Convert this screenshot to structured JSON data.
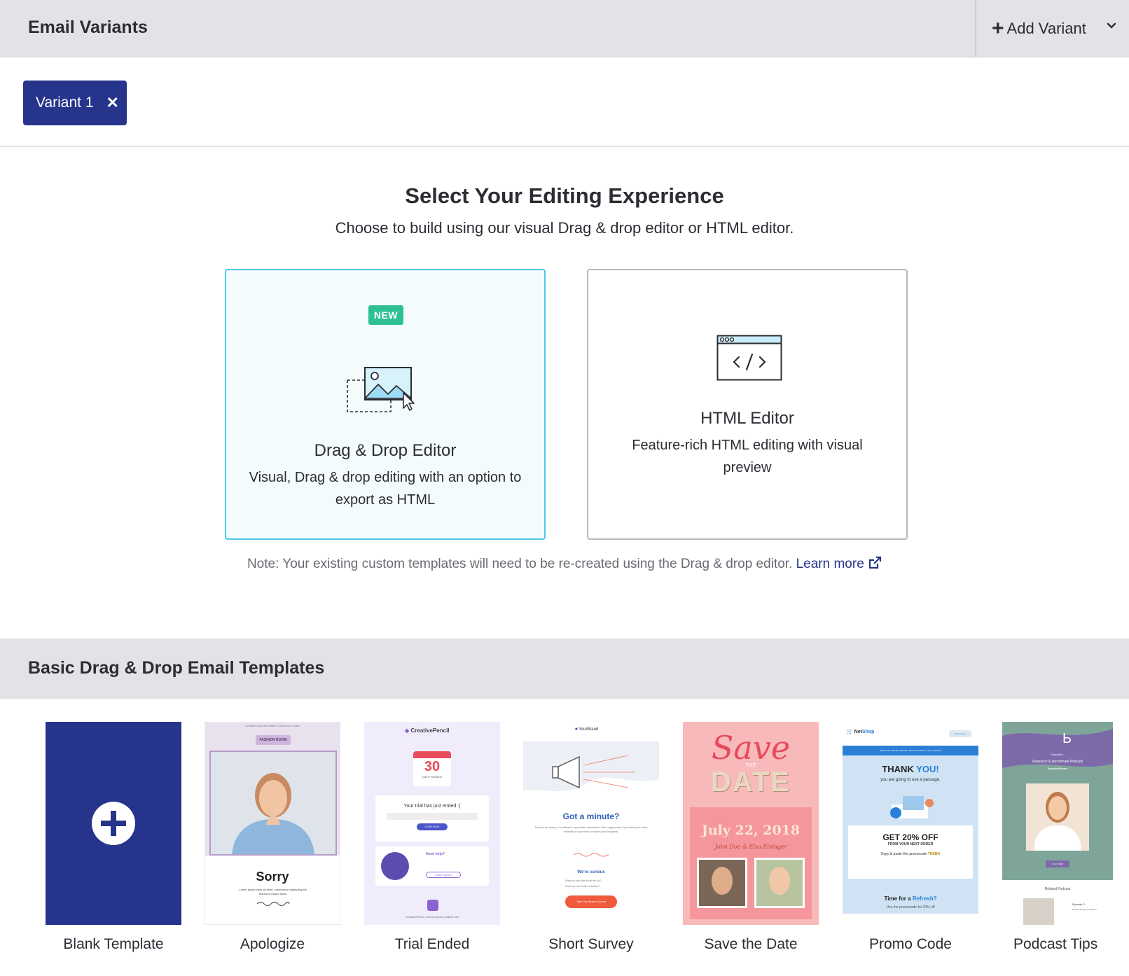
{
  "header": {
    "title": "Email Variants",
    "add_variant_label": "Add Variant"
  },
  "variants": [
    {
      "label": "Variant 1"
    }
  ],
  "editor_select": {
    "title": "Select Your Editing Experience",
    "subtitle": "Choose to build using our visual Drag & drop editor or HTML editor.",
    "drag_drop": {
      "badge": "NEW",
      "title": "Drag & Drop Editor",
      "description": "Visual, Drag & drop editing with an option to export as HTML"
    },
    "html": {
      "title": "HTML Editor",
      "description": "Feature-rich HTML editing with visual preview"
    },
    "note": "Note: Your existing custom templates will need to be re-created using the Drag & drop editor.",
    "learn_more": "Learn more"
  },
  "templates_section": {
    "title": "Basic Drag & Drop Email Templates",
    "templates": [
      {
        "label": "Blank Template"
      },
      {
        "label": "Apologize",
        "thumb": {
          "header": "Unable to see this email? Click here to view",
          "brand": "FASHION ROOM",
          "heading": "Sorry",
          "body": "Lorem ipsum dolor sit amet, consectetur adipiscing elit. Mauris ut neque tellus."
        }
      },
      {
        "label": "Trial Ended",
        "thumb": {
          "brand": "CreativePencil",
          "day": "30",
          "day_label": "DAYS PASSED",
          "heading": "Your trial has just ended :(",
          "button": "CONTINUE",
          "help": "Need help?",
          "help_button": "Lorem Ipsum",
          "footer": "CreativePencil, a lorem ipsum creative tool"
        }
      },
      {
        "label": "Short Survey",
        "thumb": {
          "brand": "YourBrand",
          "heading": "Got a minute?",
          "body": "Thanks for being a YourBrand' newsletter subscriber! We'd appreciate if you take just a few minutes of your time to share your thoughts.",
          "curious": "We're curious",
          "q1": "Why do you like what we do?",
          "q2": "How can we make it better?",
          "button": "Take YourBrand Survey"
        }
      },
      {
        "label": "Save the Date",
        "thumb": {
          "line1": "Save",
          "the": "THE",
          "line2": "DATE",
          "date": "July 22, 2018",
          "names": "John Doe & Elsa Elsinger"
        }
      },
      {
        "label": "Promo Code",
        "thumb": {
          "brand_a": "Net",
          "brand_b": "Shop",
          "account": "My account",
          "nav": "Electronics | Fashion | Books | Home and Kitchen | Toys | SALES",
          "thanks_a": "THANK ",
          "thanks_b": "YOU!",
          "thanks_sub": "you are going to use a passage.",
          "offer": "GET 20% OFF",
          "offer_sub": "FROM YOUR NEXT ORDER",
          "code_line": "Copy & paste this promocode",
          "code": "THEBO",
          "refresh_a": "Time for a ",
          "refresh_b": "Refresh?",
          "refresh_sub": "Use the promocode for 20% off"
        }
      },
      {
        "label": "Podcast Tips",
        "thumb": {
          "episode": "Episode 1",
          "heading": "Research & benchmark Podcast",
          "author": "Jessica Brown",
          "button": "PLAY NOW",
          "related": "Related Podcast",
          "ep2": "Episode 2",
          "ep2_title": "Product Design & Ideation"
        }
      }
    ]
  },
  "colors": {
    "primary": "#26348b",
    "accent_border": "#4cc8ea",
    "badge": "#2ec095",
    "header_bg": "#e2e2e7"
  }
}
